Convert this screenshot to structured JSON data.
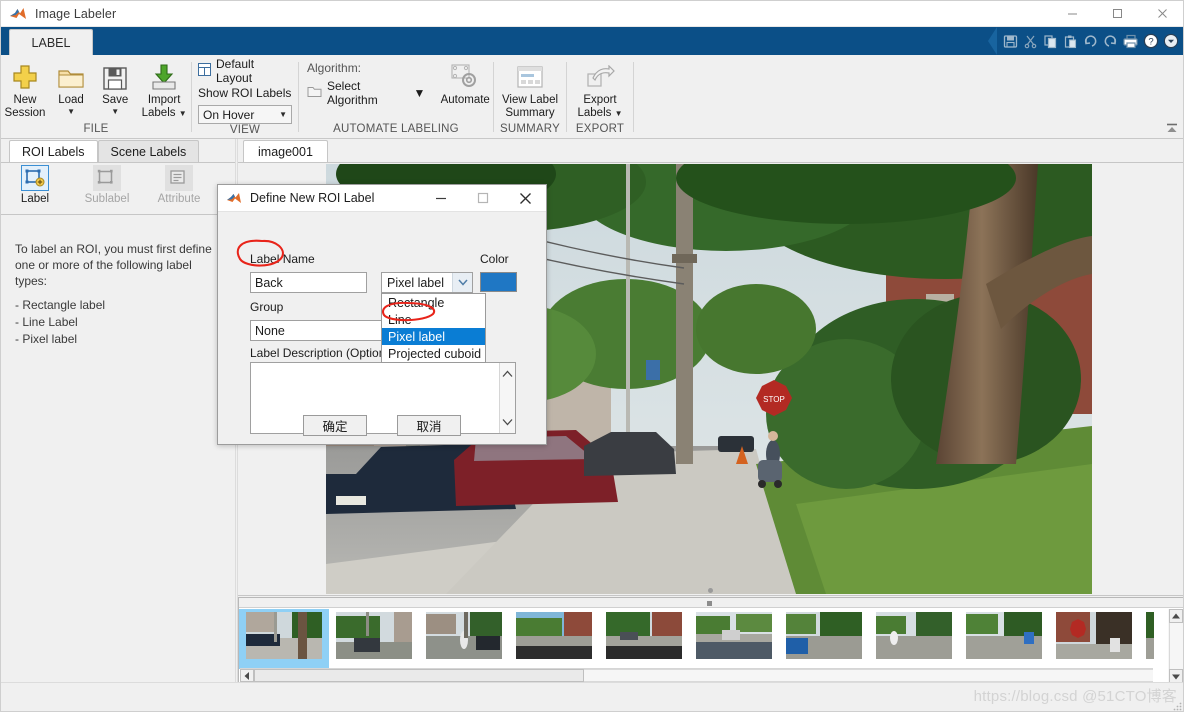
{
  "window": {
    "title": "Image Labeler",
    "controls": {
      "minimize": "minimize-icon",
      "maximize": "maximize-icon",
      "close": "close-icon"
    }
  },
  "ribbon": {
    "tab": "LABEL",
    "quick_access": [
      "save-icon",
      "cut-icon",
      "copy-icon",
      "paste-icon",
      "undo-icon",
      "redo-icon",
      "print-icon",
      "help-icon",
      "more-icon"
    ],
    "groups": [
      {
        "title": "FILE",
        "buttons": [
          {
            "label_line1": "New",
            "label_line2": "Session",
            "icon": "plus-icon",
            "caret": false
          },
          {
            "label_line1": "Load",
            "label_line2": "",
            "icon": "folder-icon",
            "caret": true
          },
          {
            "label_line1": "Save",
            "label_line2": "",
            "icon": "floppy-disk-icon",
            "caret": true
          },
          {
            "label_line1": "Import",
            "label_line2": "Labels",
            "icon": "import-arrow-icon",
            "caret": true,
            "inline_caret": true
          }
        ]
      },
      {
        "title": "VIEW",
        "default_layout": "Default Layout",
        "show_roi_labels": "Show ROI Labels",
        "on_hover_value": "On Hover"
      },
      {
        "title": "AUTOMATE LABELING",
        "algorithm_label": "Algorithm:",
        "select_algorithm": "Select Algorithm",
        "automate": "Automate"
      },
      {
        "title": "SUMMARY",
        "view_label_summary_line1": "View Label",
        "view_label_summary_line2": "Summary"
      },
      {
        "title": "EXPORT",
        "export_labels_line1": "Export",
        "export_labels_line2": "Labels"
      }
    ]
  },
  "left_panel": {
    "tabs": [
      {
        "label": "ROI Labels",
        "active": true
      },
      {
        "label": "Scene Labels",
        "active": false
      }
    ],
    "tools": [
      {
        "label": "Label",
        "icon": "roi-label-icon",
        "state": "selected"
      },
      {
        "label": "Sublabel",
        "icon": "sublabel-icon",
        "state": "disabled"
      },
      {
        "label": "Attribute",
        "icon": "attribute-icon",
        "state": "disabled"
      }
    ],
    "instructions": "To label an ROI, you must first define one or more of the following label types:",
    "label_types": [
      "- Rectangle label",
      "- Line Label",
      "- Pixel label"
    ]
  },
  "image_panel": {
    "tab": "image001"
  },
  "filmstrip": {
    "selected_index": 0,
    "count": 11
  },
  "dialog": {
    "title": "Define New ROI Label",
    "icon": "matlab-icon",
    "controls": {
      "minimize": "minimize-icon",
      "maximize": "maximize-icon",
      "close": "close-icon"
    },
    "fields": {
      "label_name_caption": "Label Name",
      "label_name_value": "Back",
      "color_caption": "Color",
      "color_value": "#1f77c4",
      "group_caption": "Group",
      "group_value": "None",
      "description_caption": "Label Description (Optional)",
      "description_value": ""
    },
    "type_dropdown": {
      "selected": "Pixel label",
      "expanded": true,
      "options": [
        "Rectangle",
        "Line",
        "Pixel label",
        "Projected cuboid"
      ]
    },
    "buttons": {
      "ok": "确定",
      "cancel": "取消"
    }
  },
  "status_bar": {
    "watermark": "https://blog.csd @51CTO博客"
  }
}
